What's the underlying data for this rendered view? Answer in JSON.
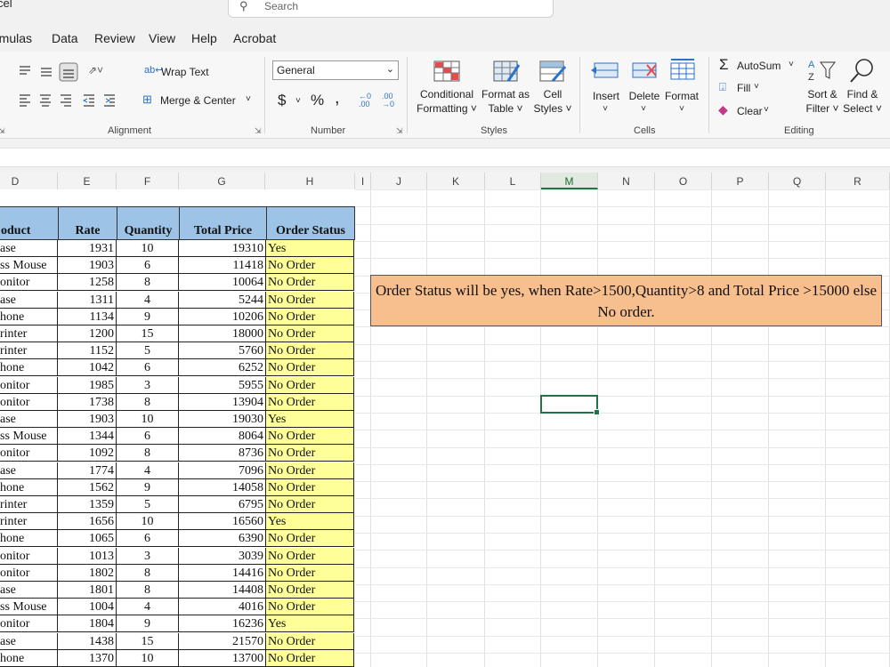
{
  "window": {
    "title": "cel"
  },
  "search": {
    "placeholder": "Search",
    "icon": "search-icon"
  },
  "menu": [
    "rmulas",
    "Data",
    "Review",
    "View",
    "Help",
    "Acrobat"
  ],
  "ribbon": {
    "alignment": {
      "wrap_text": "Wrap Text",
      "merge_center": "Merge & Center",
      "group": "Alignment"
    },
    "number": {
      "format": "General",
      "currency": "$",
      "percent": "%",
      "comma": ",",
      "group": "Number"
    },
    "styles": {
      "conditional": [
        "Conditional",
        "Formatting"
      ],
      "format_table": [
        "Format as",
        "Table"
      ],
      "cell_styles": [
        "Cell",
        "Styles"
      ],
      "group": "Styles"
    },
    "cells": {
      "insert": "Insert",
      "delete": "Delete",
      "format": "Format",
      "group": "Cells"
    },
    "editing": {
      "autosum": "AutoSum",
      "fill": "Fill",
      "clear": "Clear",
      "sort_filter": [
        "Sort &",
        "Filter"
      ],
      "find_select": [
        "Find &",
        "Select"
      ],
      "group": "Editing"
    }
  },
  "columns": [
    "D",
    "E",
    "F",
    "G",
    "H",
    "I",
    "J",
    "K",
    "L",
    "M",
    "N",
    "O",
    "P",
    "Q",
    "R"
  ],
  "selected_column": "M",
  "table": {
    "headers": [
      "oduct",
      "Rate",
      "Quantity",
      "Total Price",
      "Order Status"
    ],
    "rows": [
      [
        "ase",
        "1931",
        "10",
        "19310",
        "Yes"
      ],
      [
        "ss Mouse",
        "1903",
        "6",
        "11418",
        "No Order"
      ],
      [
        "onitor",
        "1258",
        "8",
        "10064",
        "No Order"
      ],
      [
        "ase",
        "1311",
        "4",
        "5244",
        "No Order"
      ],
      [
        "hone",
        "1134",
        "9",
        "10206",
        "No Order"
      ],
      [
        "rinter",
        "1200",
        "15",
        "18000",
        "No Order"
      ],
      [
        "rinter",
        "1152",
        "5",
        "5760",
        "No Order"
      ],
      [
        "hone",
        "1042",
        "6",
        "6252",
        "No Order"
      ],
      [
        "onitor",
        "1985",
        "3",
        "5955",
        "No Order"
      ],
      [
        "onitor",
        "1738",
        "8",
        "13904",
        "No Order"
      ],
      [
        "ase",
        "1903",
        "10",
        "19030",
        "Yes"
      ],
      [
        "ss Mouse",
        "1344",
        "6",
        "8064",
        "No Order"
      ],
      [
        "onitor",
        "1092",
        "8",
        "8736",
        "No Order"
      ],
      [
        "ase",
        "1774",
        "4",
        "7096",
        "No Order"
      ],
      [
        "hone",
        "1562",
        "9",
        "14058",
        "No Order"
      ],
      [
        "rinter",
        "1359",
        "5",
        "6795",
        "No Order"
      ],
      [
        "rinter",
        "1656",
        "10",
        "16560",
        "Yes"
      ],
      [
        "hone",
        "1065",
        "6",
        "6390",
        "No Order"
      ],
      [
        "onitor",
        "1013",
        "3",
        "3039",
        "No Order"
      ],
      [
        "onitor",
        "1802",
        "8",
        "14416",
        "No Order"
      ],
      [
        "ase",
        "1801",
        "8",
        "14408",
        "No Order"
      ],
      [
        "ss Mouse",
        "1004",
        "4",
        "4016",
        "No Order"
      ],
      [
        "onitor",
        "1804",
        "9",
        "16236",
        "Yes"
      ],
      [
        "ase",
        "1438",
        "15",
        "21570",
        "No Order"
      ],
      [
        "hone",
        "1370",
        "10",
        "13700",
        "No Order"
      ]
    ]
  },
  "note": "Order Status will be yes, when Rate>1500,Quantity>8 and Total Price >15000 else No order.",
  "colors": {
    "header_fill": "#9dc3e6",
    "status_fill": "#ffff99",
    "note_fill": "#f8bf8e",
    "accent": "#217346"
  }
}
